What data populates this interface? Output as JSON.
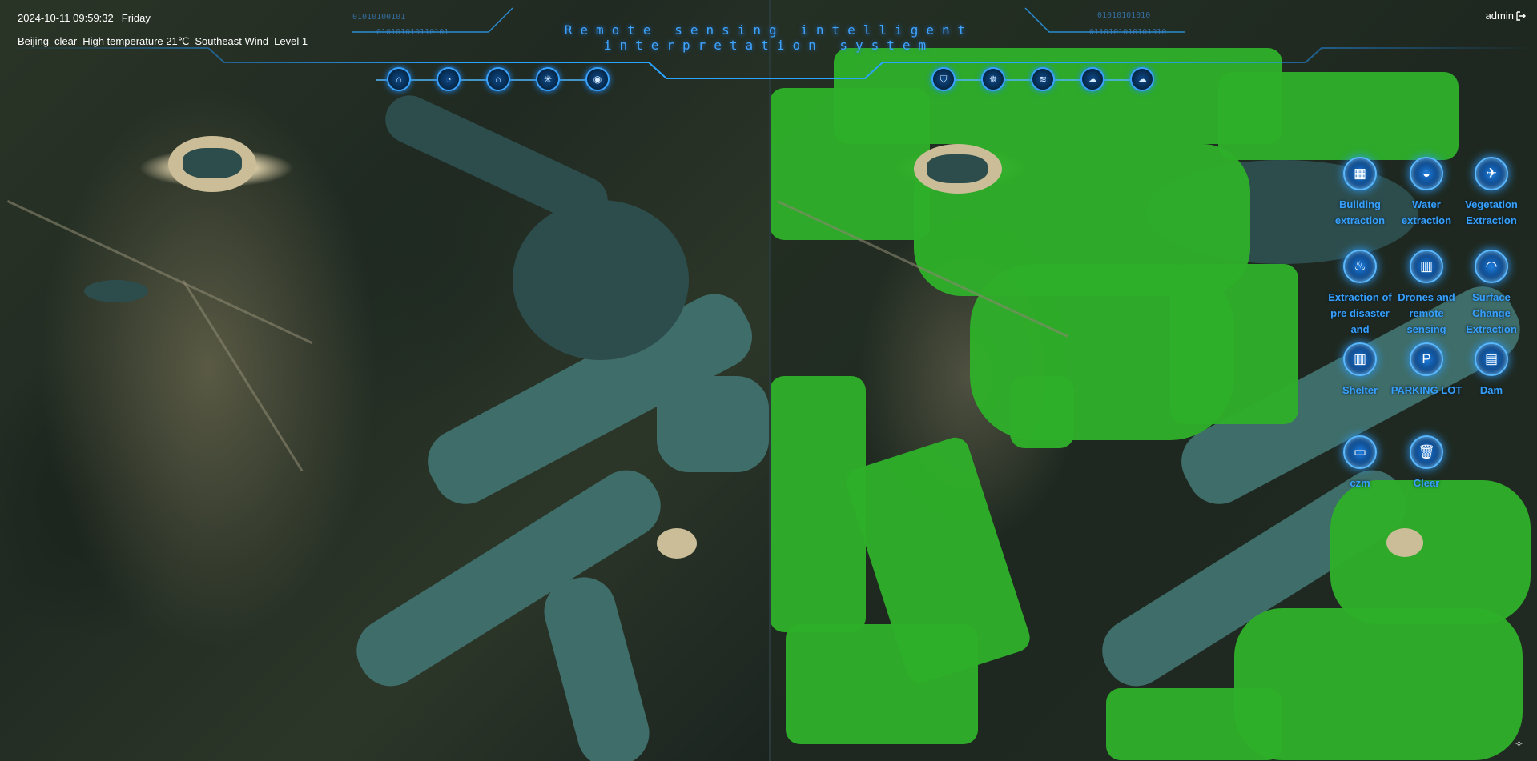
{
  "header": {
    "title": "Remote sensing intelligent interpretation system",
    "datetime": "2024-10-11 09:59:32",
    "weekday": "Friday",
    "weather": {
      "city": "Beijing",
      "condition": "clear",
      "temperature": "High temperature 21℃",
      "wind": "Southeast Wind",
      "level": "Level 1"
    },
    "user": "admin",
    "binary_left": "010101010110101",
    "binary_left2": "01010100101",
    "binary_right": "0110101010101010",
    "binary_right2": "01010101010"
  },
  "nav_left": [
    {
      "icon": "home-icon",
      "glyph": "⌂"
    },
    {
      "icon": "radar-icon",
      "glyph": "◔"
    },
    {
      "icon": "lock-icon",
      "glyph": "⌂"
    },
    {
      "icon": "network-icon",
      "glyph": "✳"
    },
    {
      "icon": "camera-icon",
      "glyph": "◉"
    }
  ],
  "nav_right": [
    {
      "icon": "shield-icon",
      "glyph": "⛉"
    },
    {
      "icon": "satellite-icon",
      "glyph": "✵"
    },
    {
      "icon": "layers-icon",
      "glyph": "≋"
    },
    {
      "icon": "cloud-upload-icon",
      "glyph": "☁"
    },
    {
      "icon": "cloud-download-icon",
      "glyph": "☁"
    }
  ],
  "tools": [
    {
      "label": "Building extraction",
      "icon": "building-icon",
      "glyph": "▦"
    },
    {
      "label": "Water extraction",
      "icon": "water-icon",
      "glyph": "◒"
    },
    {
      "label": "Vegetation Extraction",
      "icon": "airplane-icon",
      "glyph": "✈"
    },
    {
      "label": "Extraction of pre disaster and",
      "icon": "fire-icon",
      "glyph": "♨"
    },
    {
      "label": "Drones and remote sensing",
      "icon": "factory-icon",
      "glyph": "▥"
    },
    {
      "label": "Surface Change Extraction",
      "icon": "gauge-icon",
      "glyph": "◠"
    },
    {
      "label": "Shelter",
      "icon": "shelter-icon",
      "glyph": "▥"
    },
    {
      "label": "PARKING LOT",
      "icon": "parking-icon",
      "glyph": "P"
    },
    {
      "label": "Dam",
      "icon": "dam-icon",
      "glyph": "▤"
    },
    {
      "label": "czm",
      "icon": "screen-icon",
      "glyph": "▭"
    },
    {
      "label": "Clear",
      "icon": "trash-icon",
      "glyph": "🗑"
    }
  ],
  "colors": {
    "accent": "#37a0ff",
    "extraction": "#2faf2a",
    "water": "#3f6d69"
  }
}
